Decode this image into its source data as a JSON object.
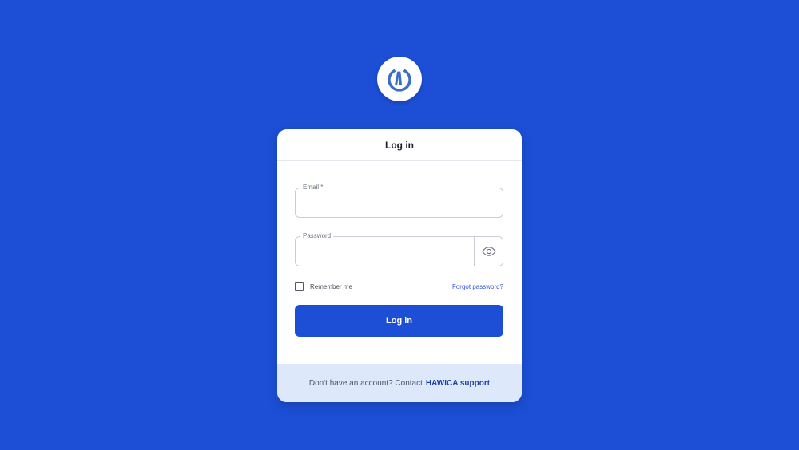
{
  "colors": {
    "background": "#1c4fd6",
    "card": "#ffffff",
    "primary_button": "#1c4fd6",
    "footer_background": "#dde9fb",
    "link": "#3557d6",
    "logo_icon": "#3a6fc4"
  },
  "logo": {
    "icon": "power-w-icon"
  },
  "card": {
    "title": "Log in",
    "email": {
      "label": "Email *",
      "value": "",
      "placeholder": ""
    },
    "password": {
      "label": "Password",
      "value": "",
      "placeholder": "",
      "toggle_icon": "eye-icon"
    },
    "remember_me": {
      "label": "Remember me",
      "checked": false
    },
    "forgot_password": "Forgot password?",
    "login_button": "Log in",
    "footer": {
      "text": "Don't have an account? Contact",
      "link": "HAWICA support"
    }
  }
}
